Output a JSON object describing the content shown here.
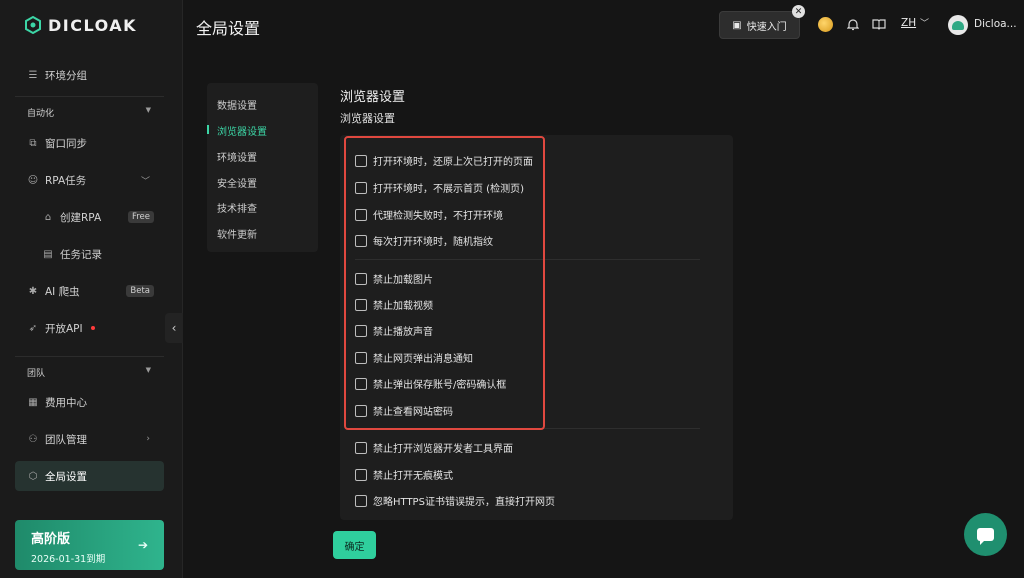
{
  "brand": {
    "logo_text": "DICLOAK",
    "accent": "#3cd6a6"
  },
  "header": {
    "page_title": "全局设置",
    "quick_start_label": "快速入门",
    "language": "ZH",
    "username": "Dicloa..."
  },
  "sidebar": {
    "items": [
      {
        "label": "环境分组",
        "icon": "list-icon"
      },
      {
        "label": "窗口同步",
        "icon": "sync-icon"
      },
      {
        "label": "RPA任务",
        "icon": "robot-icon"
      },
      {
        "label": "创建RPA",
        "icon": "store-icon",
        "badge": "Free"
      },
      {
        "label": "任务记录",
        "icon": "document-icon"
      },
      {
        "label": "AI 爬虫",
        "icon": "bug-icon",
        "badge": "Beta"
      },
      {
        "label": "开放API",
        "icon": "rocket-icon"
      },
      {
        "label": "费用中心",
        "icon": "bill-icon"
      },
      {
        "label": "团队管理",
        "icon": "team-icon"
      },
      {
        "label": "全局设置",
        "icon": "hexagon-settings-icon"
      }
    ],
    "section_automation": "自动化",
    "section_team": "团队",
    "plan": {
      "name": "高阶版",
      "expiry": "2026-01-31到期"
    }
  },
  "settings_menu": {
    "items": [
      "数据设置",
      "浏览器设置",
      "环境设置",
      "安全设置",
      "技术排查",
      "软件更新"
    ],
    "active_index": 1
  },
  "content": {
    "section_title": "浏览器设置",
    "section_subtitle": "浏览器设置",
    "options": [
      {
        "label": "打开环境时，还原上次已打开的页面",
        "checked": false
      },
      {
        "label": "打开环境时，不展示首页 (检测页)",
        "checked": false
      },
      {
        "label": "代理检测失败时，不打开环境",
        "checked": false
      },
      {
        "label": "每次打开环境时，随机指纹",
        "checked": false
      },
      {
        "label": "禁止加载图片",
        "checked": false
      },
      {
        "label": "禁止加载视频",
        "checked": false
      },
      {
        "label": "禁止播放声音",
        "checked": false
      },
      {
        "label": "禁止网页弹出消息通知",
        "checked": false
      },
      {
        "label": "禁止弹出保存账号/密码确认框",
        "checked": false
      },
      {
        "label": "禁止查看网站密码",
        "checked": false
      },
      {
        "label": "禁止打开浏览器开发者工具界面",
        "checked": false
      },
      {
        "label": "禁止打开无痕模式",
        "checked": false
      },
      {
        "label": "忽略HTTPS证书错误提示，直接打开网页",
        "checked": false
      }
    ],
    "confirm_label": "确定"
  },
  "colors": {
    "highlight_border": "#e0483f",
    "confirm_bg": "#2fcf9d",
    "plan_bg": "#2fb48d"
  }
}
